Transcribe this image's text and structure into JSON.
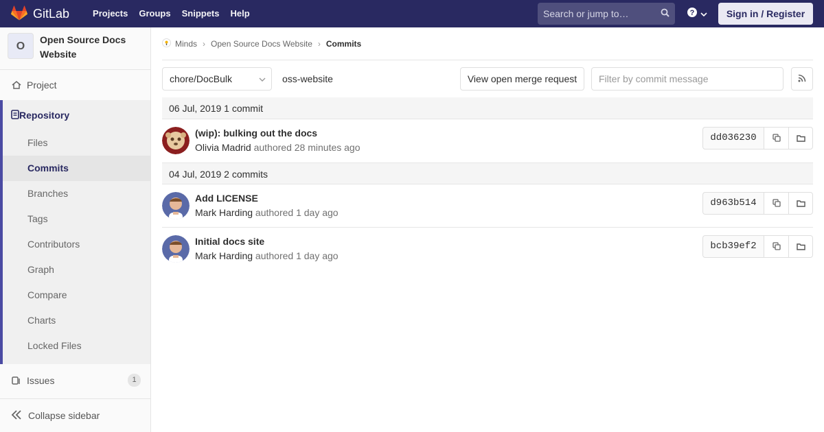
{
  "navbar": {
    "brand": "GitLab",
    "links": [
      "Projects",
      "Groups",
      "Snippets",
      "Help"
    ],
    "search_placeholder": "Search or jump to…",
    "signin": "Sign in / Register"
  },
  "sidebar": {
    "project_avatar": "O",
    "project_name": "Open Source Docs Website",
    "project_label": "Project",
    "repository_label": "Repository",
    "repository_items": [
      "Files",
      "Commits",
      "Branches",
      "Tags",
      "Contributors",
      "Graph",
      "Compare",
      "Charts",
      "Locked Files"
    ],
    "active_item": "Commits",
    "issues_label": "Issues",
    "issues_count": "1",
    "collapse_label": "Collapse sidebar"
  },
  "breadcrumb": {
    "group": "Minds",
    "project": "Open Source Docs Website",
    "current": "Commits"
  },
  "controls": {
    "branch": "chore/DocBulk",
    "path": "oss-website",
    "merge_request_button": "View open merge request",
    "filter_placeholder": "Filter by commit message"
  },
  "days": [
    {
      "header": "06 Jul, 2019 1 commit",
      "commits": [
        {
          "title": "(wip): bulking out the docs",
          "author": "Olivia Madrid",
          "authored": "authored",
          "time": "28 minutes ago",
          "sha": "dd036230"
        }
      ]
    },
    {
      "header": "04 Jul, 2019 2 commits",
      "commits": [
        {
          "title": "Add LICENSE",
          "author": "Mark Harding",
          "authored": "authored",
          "time": "1 day ago",
          "sha": "d963b514"
        },
        {
          "title": "Initial docs site",
          "author": "Mark Harding",
          "authored": "authored",
          "time": "1 day ago",
          "sha": "bcb39ef2"
        }
      ]
    }
  ],
  "colors": {
    "navbar": "#292961",
    "accent": "#4b4ba3"
  }
}
